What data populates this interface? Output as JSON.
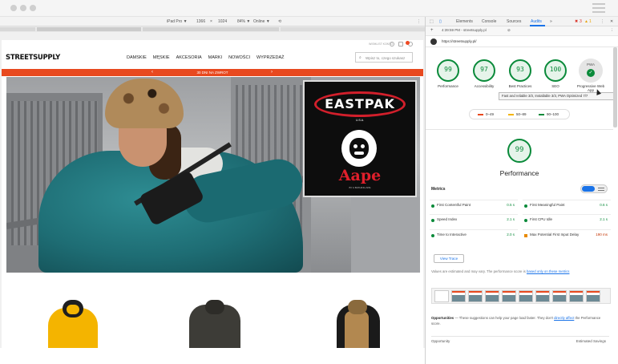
{
  "browser": {
    "emulation": {
      "device": "iPad Pro ▼",
      "width": "1366",
      "times": "×",
      "height": "1024",
      "zoom": "84% ▼",
      "network": "Online ▼"
    }
  },
  "site": {
    "top_links": "WISHLIST   KONTO",
    "logo": "STREETSUPPLY",
    "nav": [
      "DAMSKIE",
      "MĘSKIE",
      "AKCESORIA",
      "MARKI",
      "NOWOŚCI",
      "WYPRZEDAŻ"
    ],
    "search_placeholder": "Wpisz to, czego szukasz",
    "promo": {
      "text": "30 DNI NA ZWROT",
      "prev": "‹",
      "next": "›"
    },
    "hero_ad": {
      "brand": "EASTPAK",
      "usa": "U.S.A.",
      "collab": "Aape",
      "sub": "BY A BATHING APE"
    }
  },
  "devtools": {
    "tabs": [
      "Elements",
      "Console",
      "Sources",
      "Audits"
    ],
    "more": "»",
    "errors": "3",
    "warnings": "1",
    "time_url": "4:39:59 PM - streetsupply.pl",
    "audited_url": "https://streetsupply.pl/",
    "scores": [
      {
        "label": "Performance",
        "value": "99"
      },
      {
        "label": "Accessibility",
        "value": "97"
      },
      {
        "label": "Best Practices",
        "value": "93"
      },
      {
        "label": "SEO",
        "value": "100"
      }
    ],
    "pwa": {
      "label": "PWA",
      "caption": "Progressive Web App"
    },
    "tooltip": "Fast and reliable 3/3, Installable 3/3, PWA Optimized 7/7",
    "legend": [
      {
        "label": "0–49",
        "color": "#e8491f"
      },
      {
        "label": "50–89",
        "color": "#f4b400"
      },
      {
        "label": "90–100",
        "color": "#0a8a3a"
      }
    ],
    "performance": {
      "value": "99",
      "title": "Performance"
    },
    "metrics_title": "Metrics",
    "metrics": [
      {
        "name": "First Contentful Paint",
        "value": "0.5 s",
        "status": "pass"
      },
      {
        "name": "First Meaningful Paint",
        "value": "0.6 s",
        "status": "pass"
      },
      {
        "name": "Speed Index",
        "value": "2.1 s",
        "status": "pass"
      },
      {
        "name": "First CPU Idle",
        "value": "2.1 s",
        "status": "pass"
      },
      {
        "name": "Time to Interactive",
        "value": "2.0 s",
        "status": "pass"
      },
      {
        "name": "Max Potential First Input Delay",
        "value": "190 ms",
        "status": "average"
      }
    ],
    "view_trace": "View Trace",
    "estimate_note": "Values are estimated and may vary. The performance score is",
    "estimate_link": "based only on these metrics",
    "opportunities_title": "Opportunities",
    "opportunities_text": "— These suggestions can help your page load faster. They don't",
    "opportunities_link": "directly affect",
    "opportunities_tail": "the Performance score.",
    "col_opportunity": "Opportunity",
    "col_savings": "Estimated Savings",
    "colors": {
      "pass": "#0a8a3a",
      "average": "#e88a00",
      "accent": "#1a73e8"
    }
  }
}
